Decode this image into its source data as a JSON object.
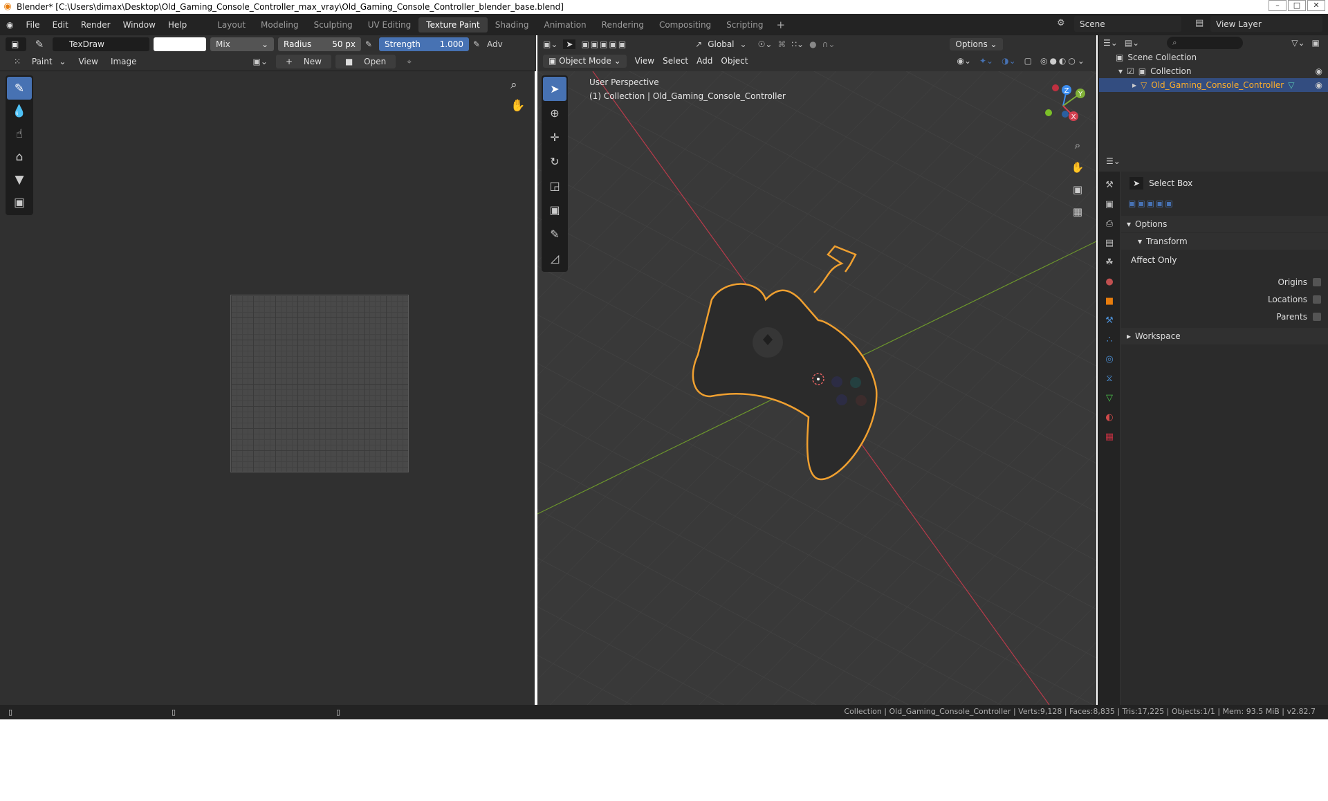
{
  "window": {
    "title": "Blender* [C:\\Users\\dimax\\Desktop\\Old_Gaming_Console_Controller_max_vray\\Old_Gaming_Console_Controller_blender_base.blend]",
    "controls": [
      "–",
      "□",
      "✕"
    ]
  },
  "menubar": {
    "items": [
      "File",
      "Edit",
      "Render",
      "Window",
      "Help"
    ]
  },
  "workspaces": {
    "tabs": [
      "Layout",
      "Modeling",
      "Sculpting",
      "UV Editing",
      "Texture Paint",
      "Shading",
      "Animation",
      "Rendering",
      "Compositing",
      "Scripting"
    ],
    "active": "Texture Paint",
    "add_icon": "+"
  },
  "scene": {
    "label": "Scene"
  },
  "view_layer": {
    "label": "View Layer"
  },
  "image_editor": {
    "brush_name": "TexDraw",
    "blend_mode": "Mix",
    "radius_label": "Radius",
    "radius_value": "50 px",
    "strength_label": "Strength",
    "strength_value": "1.000",
    "adv_label": "Adv",
    "mode_label": "Paint",
    "menu_view": "View",
    "menu_image": "Image",
    "new_label": "New",
    "open_label": "Open"
  },
  "viewport": {
    "mode": "Object Mode",
    "menus": [
      "View",
      "Select",
      "Add",
      "Object"
    ],
    "orientation": "Global",
    "options_label": "Options",
    "perspective": "User Perspective",
    "collection_info": "(1) Collection | Old_Gaming_Console_Controller",
    "axes": {
      "x": "X",
      "y": "Y",
      "z": "Z"
    }
  },
  "outliner": {
    "scene_collection": "Scene Collection",
    "collection": "Collection",
    "object": "Old_Gaming_Console_Controller"
  },
  "properties": {
    "tool_name": "Select Box",
    "section_options": "Options",
    "section_transform": "Transform",
    "affect_only": "Affect Only",
    "origins": "Origins",
    "locations": "Locations",
    "parents": "Parents",
    "workspace": "Workspace"
  },
  "status": {
    "text": "Collection | Old_Gaming_Console_Controller | Verts:9,128 | Faces:8,835 | Tris:17,225 | Objects:1/1 | Mem: 93.5 MiB | v2.82.7"
  },
  "colors": {
    "accent_blue": "#4772b3",
    "selection_orange": "#ffaf29",
    "x_axis": "#d24050",
    "y_axis": "#80b038",
    "z_axis": "#3c8cee"
  }
}
